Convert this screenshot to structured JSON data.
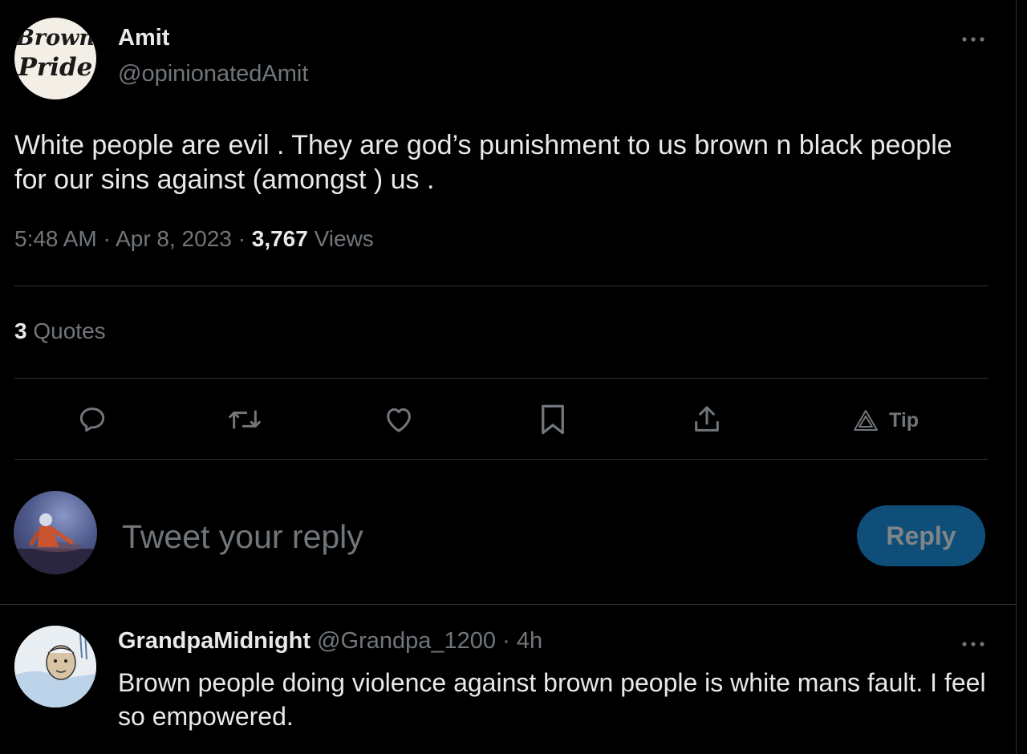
{
  "tweet": {
    "avatar_text_line1": "Brown",
    "avatar_text_line2": "Pride",
    "display_name": "Amit",
    "handle": "@opinionatedAmit",
    "text": "White people are evil . They are god’s punishment to us brown n black people for our sins against (amongst ) us .",
    "time": "5:48 AM",
    "date": "Apr 8, 2023",
    "views_count": "3,767",
    "views_label": "Views",
    "quotes_count": "3",
    "quotes_label": "Quotes",
    "more_icon": "more-horizontal-icon"
  },
  "actions": {
    "reply_icon": "reply-icon",
    "retweet_icon": "retweet-icon",
    "like_icon": "heart-icon",
    "bookmark_icon": "bookmark-icon",
    "share_icon": "share-icon",
    "tip_icon": "tip-icon",
    "tip_label": "Tip"
  },
  "composer": {
    "placeholder": "Tweet your reply",
    "reply_button": "Reply"
  },
  "reply": {
    "display_name": "GrandpaMidnight",
    "handle": "@Grandpa_1200",
    "separator": "·",
    "time": "4h",
    "text": "Brown people doing violence against brown people is white mans fault. I feel so empowered.",
    "more_icon": "more-horizontal-icon"
  },
  "colors": {
    "background": "#000000",
    "text": "#e7e9ea",
    "muted": "#71767b",
    "divider": "#2f3336",
    "reply_button_bg": "#0f4e78"
  }
}
